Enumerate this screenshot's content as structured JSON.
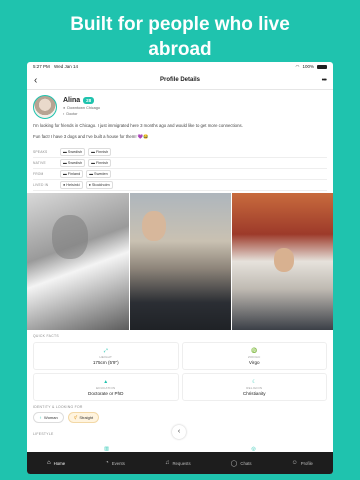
{
  "headline": {
    "line1": "Built for people who live",
    "line2": "abroad"
  },
  "status_bar": {
    "time": "5:27 PM",
    "date": "Wed Jan 14",
    "wifi_icon": "wifi-icon",
    "battery": "100%"
  },
  "nav": {
    "back": "‹",
    "title": "Profile Details",
    "more": "•••"
  },
  "profile": {
    "name": "Alina",
    "age": "28",
    "location": "Downtown Chicago",
    "occupation": "Doctor",
    "bio1": "I'm looking for friends in Chicago. I just immigrated here 3 months ago and would like to get more connections.",
    "bio2": "Fun fact! I have 3 dogs and I've built a house for them! 💜😂"
  },
  "facts": {
    "speaks": {
      "label": "SPEAKS",
      "items": [
        "Swedish",
        "Finnish"
      ]
    },
    "native": {
      "label": "NATIVE",
      "items": [
        "Swedish",
        "Finnish"
      ]
    },
    "from": {
      "label": "FROM",
      "items": [
        "Finland",
        "Sweden"
      ]
    },
    "lived_in": {
      "label": "LIVED IN",
      "items": [
        "Helsinki",
        "Stockholm"
      ]
    }
  },
  "quick_facts": {
    "title": "QUICK FACTS",
    "items": [
      {
        "label": "HEIGHT",
        "value": "175cm (5'9\")",
        "icon": "ruler-icon"
      },
      {
        "label": "ZODIAC",
        "value": "Virgo",
        "icon": "zodiac-icon"
      },
      {
        "label": "EDUCATION",
        "value": "Doctorate or PhD",
        "icon": "graduation-cap-icon"
      },
      {
        "label": "RELIGION",
        "value": "Christianity",
        "icon": "moon-icon"
      }
    ]
  },
  "identity": {
    "title": "IDENTITY & LOOKING FOR",
    "items": [
      "Woman",
      "Straight"
    ]
  },
  "lifestyle": {
    "title": "LIFESTYLE"
  },
  "tabs": [
    {
      "label": "Home",
      "icon": "home-icon"
    },
    {
      "label": "Events",
      "icon": "events-icon"
    },
    {
      "label": "Requests",
      "icon": "bell-icon"
    },
    {
      "label": "Chats",
      "icon": "chat-icon"
    },
    {
      "label": "Profile",
      "icon": "user-icon"
    }
  ],
  "colors": {
    "accent": "#1fc3ae",
    "tabbar": "#1d1d1d"
  }
}
